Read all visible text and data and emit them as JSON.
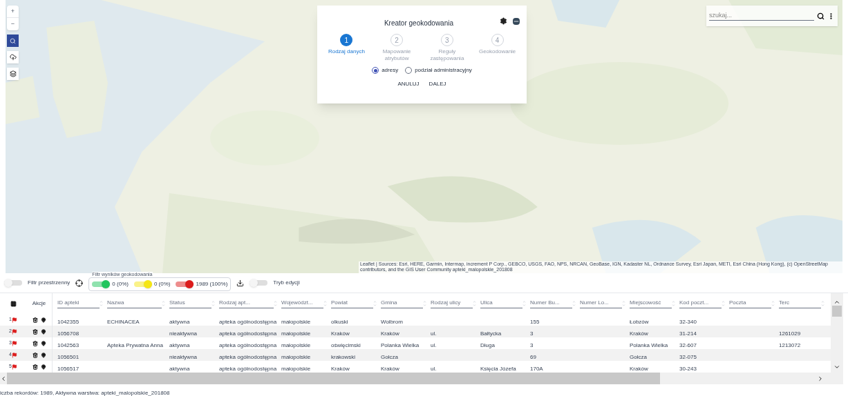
{
  "map": {
    "zoom_in": "+",
    "zoom_out": "−",
    "attribution": "Leaflet | Sources: Esri, HERE, Garmin, Intermap, increment P Corp., GEBCO, USGS, FAO, NPS, NRCAN, GeoBase, IGN, Kadaster NL, Ordnance Survey, Esri Japan, METI, Esri China (Hong Kong), (c) OpenStreetMap contributors, and the GIS User Community apteki_malopolskie_201808"
  },
  "search": {
    "placeholder": "szukaj..."
  },
  "dialog": {
    "title": "Kreator geokodowania",
    "steps": [
      {
        "number": "1",
        "label": "Rodzaj danych",
        "selected": true
      },
      {
        "number": "2",
        "label": "Mapowanie atrybutów",
        "selected": false
      },
      {
        "number": "3",
        "label": "Reguły zastępowania",
        "selected": false
      },
      {
        "number": "4",
        "label": "Geokodowanie",
        "selected": false
      }
    ],
    "options": [
      {
        "label": "adresy",
        "selected": true
      },
      {
        "label": "podział administracyjny",
        "selected": false
      }
    ],
    "buttons": [
      "ANULUJ",
      "DALEJ"
    ]
  },
  "toolbar": {
    "spatial_filter": {
      "label": "Filtr przestrzenny",
      "on": false
    },
    "geocode_filter": {
      "legend": "Filtr wyników geokodowania",
      "items": [
        {
          "label": "0 (0%)",
          "on": true,
          "color": "#22c55e"
        },
        {
          "label": "0 (0%)",
          "on": true,
          "color": "#f5e614"
        },
        {
          "label": "1989 (100%)",
          "on": true,
          "color": "#dc1c1c"
        }
      ]
    },
    "edit_mode": {
      "label": "Tryb edycji",
      "on": false
    }
  },
  "table": {
    "actions_label": "Akcje",
    "columns": [
      {
        "label": "ID apteki"
      },
      {
        "label": "Nazwa"
      },
      {
        "label": "Status"
      },
      {
        "label": "Rodzaj apt..."
      },
      {
        "label": "Województ..."
      },
      {
        "label": "Powiat"
      },
      {
        "label": "Gmina"
      },
      {
        "label": "Rodzaj ulicy"
      },
      {
        "label": "Ulica"
      },
      {
        "label": "Numer Bu..."
      },
      {
        "label": "Numer Lo..."
      },
      {
        "label": "Miejscowość"
      },
      {
        "label": "Kod poczt..."
      },
      {
        "label": "Poczta"
      },
      {
        "label": "Terc"
      }
    ],
    "rows": [
      {
        "number": "1",
        "color": "#dc1c1c",
        "cells": [
          "1042355",
          "ECHINACEA",
          "aktywna",
          "apteka ogólnodostępna",
          "małopolskie",
          "olkuski",
          "Wolbrom",
          "",
          "",
          "155",
          "",
          "Łobzów",
          "32-340",
          "",
          ""
        ]
      },
      {
        "number": "2",
        "color": "#dc1c1c",
        "cells": [
          "1056708",
          "",
          "nieaktywna",
          "apteka ogólnodostępna",
          "małopolskie",
          "Kraków",
          "Kraków",
          "ul.",
          "Bałtycka",
          "3",
          "",
          "Kraków",
          "31-214",
          "",
          "1261029"
        ]
      },
      {
        "number": "3",
        "color": "#dc1c1c",
        "cells": [
          "1042563",
          "Apteka Prywatna Anna",
          "aktywna",
          "apteka ogólnodostępna",
          "małopolskie",
          "oświęcimski",
          "Polanka Wielka",
          "ul.",
          "Długa",
          "3",
          "",
          "Polanka Wielka",
          "32-607",
          "",
          "1213072"
        ]
      },
      {
        "number": "4",
        "color": "#dc1c1c",
        "cells": [
          "1056501",
          "",
          "nieaktywna",
          "apteka ogólnodostępna",
          "małopolskie",
          "krakowski",
          "Gołcza",
          "",
          "",
          "69",
          "",
          "Gołcza",
          "32-075",
          "",
          ""
        ]
      },
      {
        "number": "5",
        "color": "#dc1c1c",
        "cells": [
          "1056517",
          "",
          "aktywna",
          "apteka ogólnodostępna",
          "małopolskie",
          "Kraków",
          "Kraków",
          "ul.",
          "Księcia Józefa",
          "170A",
          "",
          "Kraków",
          "30-243",
          "",
          ""
        ]
      }
    ]
  },
  "status_bar": "iczba rekordów: 1989, Aktywna warstwa: apteki_malopolskie_201808"
}
